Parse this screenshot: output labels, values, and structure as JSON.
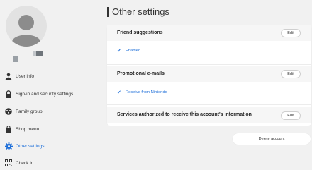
{
  "profile": {
    "avatar_icon": "default-user-icon"
  },
  "nav": {
    "items": [
      {
        "label": "User info",
        "icon": "user-icon"
      },
      {
        "label": "Sign-in and security settings",
        "icon": "lock-icon"
      },
      {
        "label": "Family group",
        "icon": "family-icon"
      },
      {
        "label": "Shop menu",
        "icon": "shopping-bag-icon"
      },
      {
        "label": "Other settings",
        "icon": "gear-icon",
        "active": true
      },
      {
        "label": "Check in",
        "icon": "qr-code-icon"
      }
    ]
  },
  "main": {
    "title": "Other settings",
    "sections": [
      {
        "title": "Friend suggestions",
        "edit_label": "Edit",
        "value": "Enabled"
      },
      {
        "title": "Promotional e-mails",
        "edit_label": "Edit",
        "value": "Receive from Nintendo"
      },
      {
        "title": "Services authorized to receive this account's information",
        "edit_label": "Edit"
      }
    ],
    "delete_label": "Delete account"
  },
  "colors": {
    "accent": "#1e6fd9",
    "background": "#f1f1f1",
    "card": "#ffffff",
    "section_header": "#f6f6f6"
  }
}
